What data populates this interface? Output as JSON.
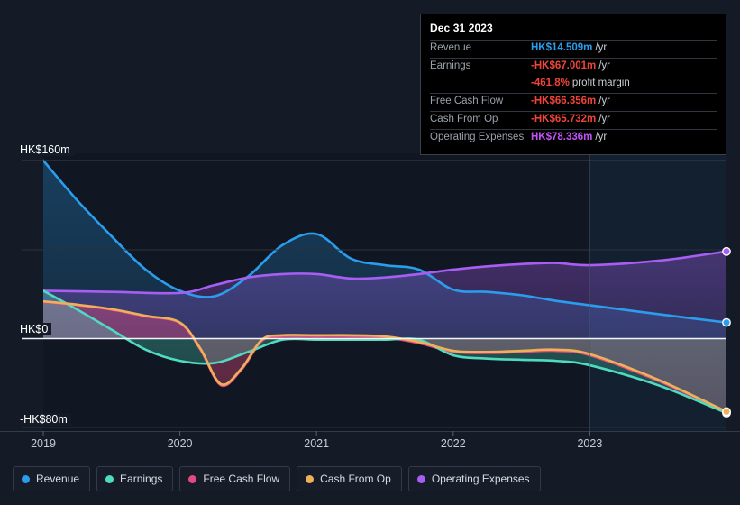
{
  "chart_data": {
    "type": "area",
    "title": "",
    "xlabel": "",
    "ylabel": "",
    "currency": "HK$",
    "unit": "m",
    "x_ticks": [
      "2019",
      "2020",
      "2021",
      "2022",
      "2023"
    ],
    "y_ticks": [
      "HK$160m",
      "HK$0",
      "-HK$80m"
    ],
    "ylim": [
      -80,
      160
    ],
    "xlim": [
      2018.8,
      2024.0
    ],
    "grid": true,
    "zero_line": true,
    "forecast_divider_x": "2023",
    "legend_position": "bottom-left",
    "series": [
      {
        "name": "Revenue",
        "color": "#2a9dec",
        "x": [
          2019.0,
          2019.25,
          2019.5,
          2019.75,
          2020.0,
          2020.25,
          2020.5,
          2020.75,
          2021.0,
          2021.25,
          2021.5,
          2021.75,
          2022.0,
          2022.25,
          2022.5,
          2022.75,
          2023.0,
          2023.5,
          2024.0
        ],
        "values": [
          160.0,
          124.0,
          92.0,
          62.0,
          43.0,
          38.0,
          56.0,
          84.0,
          94.0,
          72.0,
          66.0,
          62.0,
          44.0,
          42.0,
          39.0,
          34.0,
          30.0,
          22.0,
          14.509
        ]
      },
      {
        "name": "Earnings",
        "color": "#4edbc0",
        "x": [
          2019.0,
          2019.25,
          2019.5,
          2019.75,
          2020.0,
          2020.25,
          2020.5,
          2020.75,
          2021.0,
          2021.25,
          2021.5,
          2021.75,
          2022.0,
          2022.25,
          2022.5,
          2022.75,
          2023.0,
          2023.5,
          2024.0
        ],
        "values": [
          43.0,
          26.0,
          8.0,
          -10.0,
          -20.0,
          -22.0,
          -12.0,
          -1.0,
          -1.0,
          -1.0,
          -1.0,
          -1.0,
          -15.0,
          -18.0,
          -19.0,
          -20.0,
          -24.0,
          -42.0,
          -67.001
        ]
      },
      {
        "name": "Free Cash Flow",
        "color": "#e34a7f",
        "x": [
          2019.0,
          2019.25,
          2019.5,
          2019.75,
          2020.0,
          2020.15,
          2020.3,
          2020.45,
          2020.6,
          2020.75,
          2021.0,
          2021.25,
          2021.5,
          2021.75,
          2022.0,
          2022.25,
          2022.5,
          2022.75,
          2023.0,
          2023.5,
          2024.0
        ],
        "values": [
          33.0,
          30.0,
          26.0,
          20.0,
          14.0,
          -10.0,
          -42.0,
          -28.0,
          -2.0,
          2.0,
          2.0,
          2.0,
          1.0,
          -4.0,
          -12.0,
          -13.0,
          -12.0,
          -11.0,
          -15.0,
          -38.0,
          -66.356
        ]
      },
      {
        "name": "Cash From Op",
        "color": "#efb05a",
        "x": [
          2019.0,
          2019.25,
          2019.5,
          2019.75,
          2020.0,
          2020.15,
          2020.3,
          2020.45,
          2020.6,
          2020.75,
          2021.0,
          2021.25,
          2021.5,
          2021.75,
          2022.0,
          2022.25,
          2022.5,
          2022.75,
          2023.0,
          2023.5,
          2024.0
        ],
        "values": [
          33.5,
          30.5,
          26.5,
          20.5,
          14.5,
          -9.0,
          -41.0,
          -27.0,
          -1.0,
          3.0,
          3.0,
          3.0,
          2.0,
          -3.0,
          -11.0,
          -12.0,
          -11.0,
          -10.0,
          -14.0,
          -37.0,
          -65.732
        ]
      },
      {
        "name": "Operating Expenses",
        "color": "#a85ef2",
        "x": [
          2019.0,
          2019.5,
          2020.0,
          2020.25,
          2020.5,
          2020.75,
          2021.0,
          2021.25,
          2021.5,
          2021.75,
          2022.0,
          2022.25,
          2022.5,
          2022.75,
          2023.0,
          2023.5,
          2024.0
        ],
        "values": [
          43.0,
          42.0,
          41.0,
          48.0,
          55.0,
          58.0,
          58.0,
          54.0,
          55.0,
          58.0,
          62.0,
          65.0,
          67.0,
          68.0,
          66.0,
          70.0,
          78.336
        ]
      }
    ]
  },
  "tooltip": {
    "date": "Dec 31 2023",
    "rows": [
      {
        "label": "Revenue",
        "value": "HK$14.509m",
        "unit": "/yr",
        "color": "#2a9dec"
      },
      {
        "label": "Earnings",
        "value": "-HK$67.001m",
        "unit": "/yr",
        "color": "#f04438"
      },
      {
        "label": "",
        "value": "-461.8%",
        "unit": "profit margin",
        "color": "#f04438"
      },
      {
        "label": "Free Cash Flow",
        "value": "-HK$66.356m",
        "unit": "/yr",
        "color": "#f04438"
      },
      {
        "label": "Cash From Op",
        "value": "-HK$65.732m",
        "unit": "/yr",
        "color": "#f04438"
      },
      {
        "label": "Operating Expenses",
        "value": "HK$78.336m",
        "unit": "/yr",
        "color": "#c254f5"
      }
    ]
  },
  "legend": {
    "items": [
      {
        "label": "Revenue",
        "color": "#2a9dec"
      },
      {
        "label": "Earnings",
        "color": "#4edbc0"
      },
      {
        "label": "Free Cash Flow",
        "color": "#e34a7f"
      },
      {
        "label": "Cash From Op",
        "color": "#efb05a"
      },
      {
        "label": "Operating Expenses",
        "color": "#a85ef2"
      }
    ]
  },
  "axes": {
    "y_top": "HK$160m",
    "y_zero": "HK$0",
    "y_bottom": "-HK$80m",
    "x_labels": [
      "2019",
      "2020",
      "2021",
      "2022",
      "2023"
    ]
  }
}
